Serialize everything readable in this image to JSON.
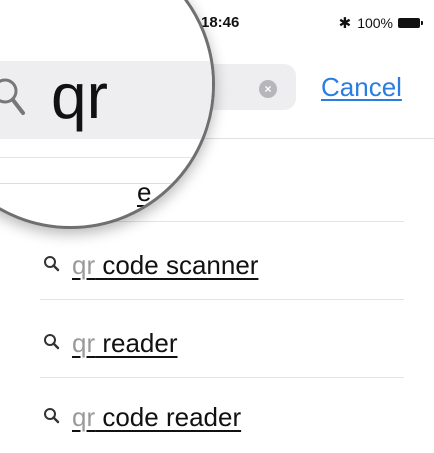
{
  "status_bar": {
    "time": "18:46",
    "bluetooth_icon": "bluetooth-icon",
    "battery_percent": "100%",
    "battery_icon": "battery-icon"
  },
  "search": {
    "query": "qr",
    "search_icon": "search-icon",
    "clear_icon": "clear-icon",
    "clear_glyph": "×",
    "cancel_label": "Cancel"
  },
  "magnifier": {
    "partial_suggestion": "e"
  },
  "suggestions": [
    {
      "prefix": "qr",
      "rest": " code scanner",
      "icon": "search-icon"
    },
    {
      "prefix": "qr",
      "rest": " reader",
      "icon": "search-icon"
    },
    {
      "prefix": "qr",
      "rest": " code reader",
      "icon": "search-icon"
    }
  ],
  "colors": {
    "accent": "#2a7de1",
    "field_background": "#eeeef0",
    "prefix_text": "#9a9a9a"
  }
}
